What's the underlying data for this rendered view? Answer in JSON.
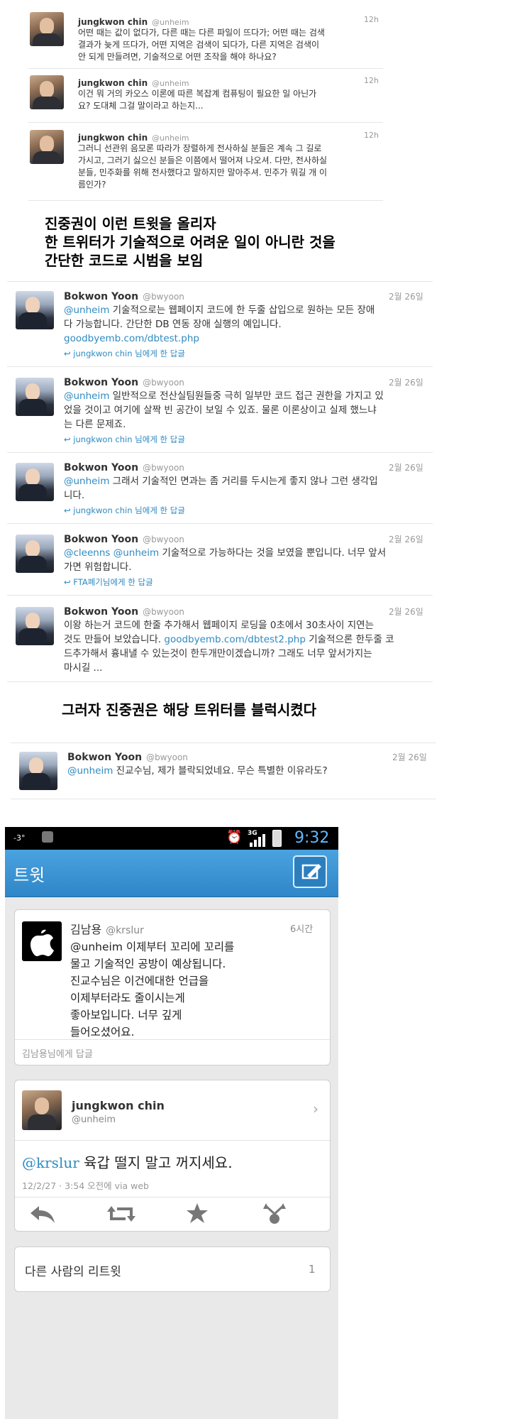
{
  "chin_tweets": [
    {
      "name": "jungkwon chin",
      "handle": "@unheim",
      "time": "12h",
      "lines": [
        "어떤 때는 값이 없다가, 다른 때는 다른 파일이 뜨다가; 어떤 때는 검색",
        "결과가 늦게 뜨다가, 어떤 지역은 검색이 되다가, 다른 지역은 검색이",
        "안 되게 만들려면, 기술적으로 어떤 조작을 해야 하나요?"
      ]
    },
    {
      "name": "jungkwon chin",
      "handle": "@unheim",
      "time": "12h",
      "lines": [
        "이건 뭐 거의 카오스 이론에 따른 복잡계 컴퓨팅이 필요한 일 아닌가",
        "요? 도대체 그걸 말이라고 하는지..."
      ]
    },
    {
      "name": "jungkwon chin",
      "handle": "@unheim",
      "time": "12h",
      "lines": [
        "그러니 선관위 음모론 따라가 장렬하게 전사하실 분들은 계속 그 길로",
        "가시고, 그러기 싫으신 분들은 이쯤에서 떨어져 나오셔. 다만, 전사하실",
        "분들, 민주화를 위해 전사했다고 말하지만 말아주셔. 민주가 뭐길 개 이",
        "름인가?"
      ]
    }
  ],
  "caption1": [
    "진중권이 이런 트윗을 올리자",
    "한 트위터가 기술적으로 어려운 일이 아니란 것을",
    "간단한 코드로 시범을 보임"
  ],
  "yoon_tweets": [
    {
      "name": "Bokwon Yoon",
      "handle": "@bwyoon",
      "time": "2월 26일",
      "mention": "@unheim",
      "line1": " 기술적으로는 웹페이지 코드에 한 두줄 삽입으로 원하는 모든 장애",
      "line2": "다 가능합니다. 간단한 DB 연동 장애 실행의 예입니다.",
      "link": "goodbyemb.com/dbtest.php",
      "reply": "jungkwon chin 님에게 한 답글"
    },
    {
      "name": "Bokwon Yoon",
      "handle": "@bwyoon",
      "time": "2월 26일",
      "mention": "@unheim",
      "line1": " 일반적으로 전산실팀원들중 극히 일부만 코드 접근 권한을 가지고 있",
      "line2": "었을 것이고 여기에 살짝 빈 공간이 보일 수 있죠. 물론 이론상이고 실제 했느냐",
      "line3": "는 다른 문제죠.",
      "reply": "jungkwon chin 님에게 한 답글"
    },
    {
      "name": "Bokwon Yoon",
      "handle": "@bwyoon",
      "time": "2월 26일",
      "mention": "@unheim",
      "line1": " 그래서 기술적인 면과는 좀 거리를 두시는게 좋지 않나 그런 생각입",
      "line2": "니다.",
      "reply": "jungkwon chin 님에게 한 답글"
    },
    {
      "name": "Bokwon Yoon",
      "handle": "@bwyoon",
      "time": "2월 26일",
      "mention": "@cleenns",
      "mention2": "@unheim",
      "line1": " 기술적으로 가능하다는 것을 보였을 뿐입니다. 너무 앞서",
      "line2": "가면 위험합니다.",
      "reply": "FTA폐기님에게 한 답글"
    },
    {
      "name": "Bokwon Yoon",
      "handle": "@bwyoon",
      "time": "2월 26일",
      "line1": "이왕 하는거 코드에 한줄 추가해서 웹페이지 로딩을 0초에서 30초사이 지연는",
      "line2a": "것도 만들어 보았습니다. ",
      "link": "goodbyemb.com/dbtest2.php",
      "line2b": " 기술적으론 한두줄 코",
      "line3": "드추가해서 흉내낼 수 있는것이 한두개만이겠습니까? 그래도 너무 앞서가지는",
      "line4": "마시길 ..."
    }
  ],
  "caption2": "그러자 진중권은 해당 트위터를 블럭시켰다",
  "yoon_last": {
    "name": "Bokwon Yoon",
    "handle": "@bwyoon",
    "time": "2월 26일",
    "mention": "@unheim",
    "text": " 진교수님, 제가 블락되었네요. 무슨 특별한 이유라도?"
  },
  "phone": {
    "status": {
      "signal": "-3°",
      "network": "3G",
      "time": "9:32"
    },
    "appbar_title": "트윗",
    "kim": {
      "name": "김남용",
      "handle": "@krslur",
      "time": "6시간",
      "lines": [
        "@unheim 이제부터 꼬리에 꼬리를",
        "물고 기술적인 공방이 예상됩니다.",
        "진교수님은 이건에대한 언급을",
        "이제부터라도 줄이시는게",
        "좋아보입니다. 너무 깊게",
        "들어오셨어요."
      ],
      "reply_label": "김남용님에게 답글"
    },
    "chin": {
      "name": "jungkwon chin",
      "handle": "@unheim",
      "mention": "@krslur",
      "text": " 육갑 떨지 말고 꺼지세요.",
      "meta": "12/2/27 · 3:54 오전에 via web"
    },
    "retweets": {
      "label": "다른 사람의 리트윗",
      "count": "1"
    },
    "colors": {
      "appbar": "#3a95d6",
      "link": "#2f8ac1"
    }
  }
}
